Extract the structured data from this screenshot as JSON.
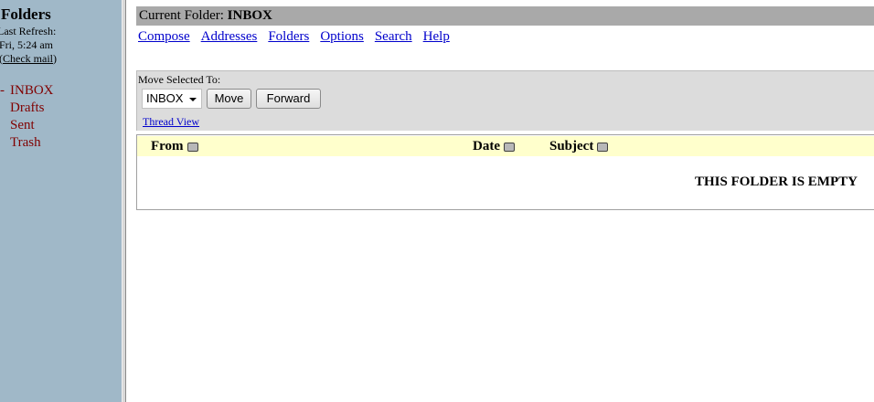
{
  "sidebar": {
    "title": "Folders",
    "last_refresh_label": "Last Refresh:",
    "last_refresh_time": "Fri, 5:24 am",
    "check_mail_open": "(",
    "check_mail_label": "Check mail",
    "check_mail_close": ")",
    "current_marker": "-",
    "folders": [
      {
        "label": "INBOX"
      },
      {
        "label": "Drafts"
      },
      {
        "label": "Sent"
      },
      {
        "label": "Trash"
      }
    ]
  },
  "header": {
    "current_folder_label": "Current Folder:",
    "current_folder": "INBOX"
  },
  "nav": {
    "items": [
      {
        "label": "Compose"
      },
      {
        "label": "Addresses"
      },
      {
        "label": "Folders"
      },
      {
        "label": "Options"
      },
      {
        "label": "Search"
      },
      {
        "label": "Help"
      }
    ]
  },
  "move": {
    "label": "Move Selected To:",
    "selected_folder": "INBOX",
    "move_button": "Move",
    "forward_button": "Forward",
    "thread_view": "Thread View"
  },
  "message_list": {
    "columns": [
      {
        "label": "From"
      },
      {
        "label": "Date"
      },
      {
        "label": "Subject"
      }
    ],
    "empty_message": "THIS FOLDER IS EMPTY"
  },
  "colors": {
    "sidebar_bg": "#a0b8c8",
    "folder_link": "#800000",
    "nav_link": "#0000cc",
    "header_bar": "#a9a9a9",
    "list_header_bg": "#ffffcc"
  }
}
